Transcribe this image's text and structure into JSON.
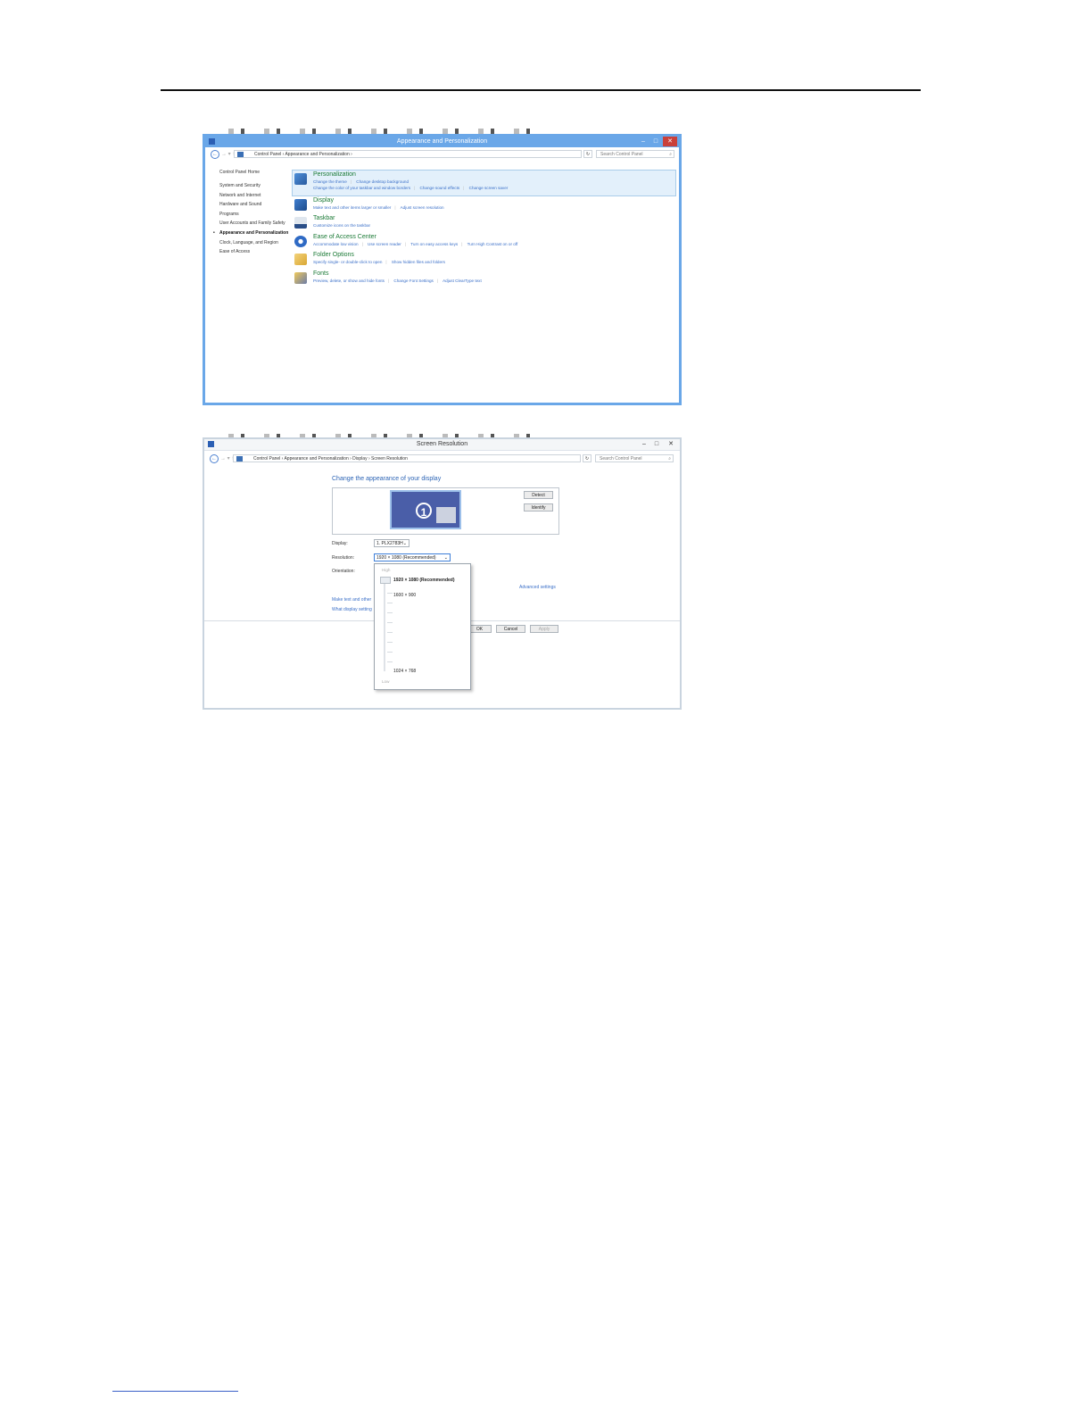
{
  "window1": {
    "title": "Appearance and Personalization",
    "min": "–",
    "max": "□",
    "close": "✕",
    "breadcrumb": "Control Panel  ›  Appearance and Personalization  ›",
    "search_placeholder": "Search Control Panel",
    "sidebar": [
      "Control Panel Home",
      "System and Security",
      "Network and Internet",
      "Hardware and Sound",
      "Programs",
      "User Accounts and Family Safety",
      "Appearance and Personalization",
      "Clock, Language, and Region",
      "Ease of Access"
    ],
    "categories": [
      {
        "title": "Personalization",
        "links1": [
          "Change the theme",
          "Change desktop background"
        ],
        "links2": [
          "Change the color of your taskbar and window borders",
          "Change sound effects",
          "Change screen saver"
        ]
      },
      {
        "title": "Display",
        "links1": [
          "Make text and other items larger or smaller",
          "Adjust screen resolution"
        ]
      },
      {
        "title": "Taskbar",
        "links1": [
          "Customize icons on the taskbar"
        ]
      },
      {
        "title": "Ease of Access Center",
        "links1": [
          "Accommodate low vision",
          "Use screen reader",
          "Turn on easy access keys",
          "Turn High Contrast on or off"
        ]
      },
      {
        "title": "Folder Options",
        "links1": [
          "Specify single- or double-click to open",
          "Show hidden files and folders"
        ]
      },
      {
        "title": "Fonts",
        "links1": [
          "Preview, delete, or show and hide fonts",
          "Change Font Settings",
          "Adjust ClearType text"
        ]
      }
    ],
    "colors": {
      "accent": "#6aa7e8",
      "category_title": "#1b7a36",
      "link": "#3a6fc8"
    }
  },
  "window2": {
    "title": "Screen Resolution",
    "breadcrumb": "Control Panel  ›  Appearance and Personalization  ›  Display  ›  Screen Resolution",
    "search_placeholder": "Search Control Panel",
    "heading": "Change the appearance of your display",
    "monitor_number": "1",
    "detect": "Detect",
    "identify": "Identify",
    "display_label": "Display:",
    "display_value": "1. PLX2783H",
    "resolution_label": "Resolution:",
    "resolution_value": "1920 × 1080 (Recommended)",
    "orientation_label": "Orientation:",
    "advanced": "Advanced settings",
    "link_text_size": "Make text and other",
    "link_display_settings": "What display setting",
    "ok": "OK",
    "cancel": "Cancel",
    "apply": "Apply",
    "dropdown": {
      "high": "High",
      "low": "Low",
      "options": [
        "1920 × 1080 (Recommended)",
        "1600 × 900",
        "1024 × 768"
      ]
    }
  }
}
